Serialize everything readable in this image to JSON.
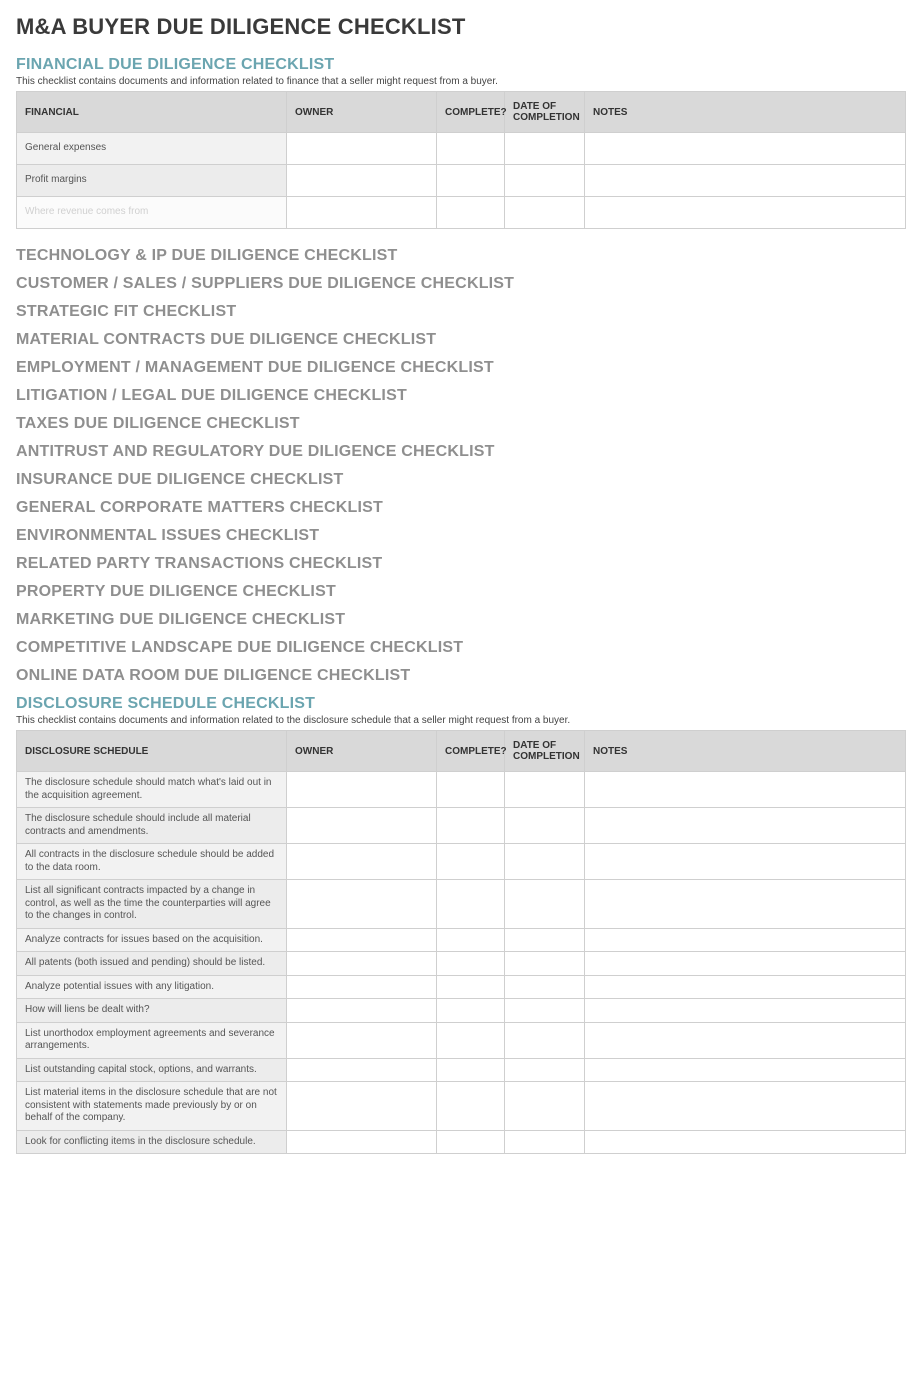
{
  "page_title": "M&A BUYER DUE DILIGENCE CHECKLIST",
  "financial": {
    "title": "FINANCIAL DUE DILIGENCE CHECKLIST",
    "desc": "This checklist contains documents and information related to finance that a seller might request from a buyer.",
    "headers": {
      "first": "FINANCIAL",
      "owner": "OWNER",
      "complete": "COMPLETE?",
      "date": "DATE OF COMPLETION",
      "notes": "NOTES"
    },
    "rows": [
      {
        "item": "General expenses",
        "owner": "",
        "complete": "",
        "date": "",
        "notes": "",
        "fade": false
      },
      {
        "item": "Profit margins",
        "owner": "",
        "complete": "",
        "date": "",
        "notes": "",
        "fade": false
      },
      {
        "item": "Where revenue comes from",
        "owner": "",
        "complete": "",
        "date": "",
        "notes": "",
        "fade": true
      }
    ]
  },
  "middle_sections": [
    "TECHNOLOGY & IP DUE DILIGENCE CHECKLIST",
    "CUSTOMER / SALES / SUPPLIERS DUE DILIGENCE CHECKLIST",
    "STRATEGIC FIT CHECKLIST",
    "MATERIAL CONTRACTS DUE DILIGENCE CHECKLIST",
    "EMPLOYMENT / MANAGEMENT DUE DILIGENCE CHECKLIST",
    "LITIGATION / LEGAL DUE DILIGENCE CHECKLIST",
    "TAXES DUE DILIGENCE CHECKLIST",
    "ANTITRUST AND REGULATORY DUE DILIGENCE CHECKLIST",
    "INSURANCE DUE DILIGENCE CHECKLIST",
    "GENERAL CORPORATE MATTERS CHECKLIST",
    "ENVIRONMENTAL ISSUES CHECKLIST",
    "RELATED PARTY TRANSACTIONS CHECKLIST",
    "PROPERTY DUE DILIGENCE CHECKLIST",
    "MARKETING DUE DILIGENCE CHECKLIST",
    "COMPETITIVE LANDSCAPE DUE DILIGENCE CHECKLIST",
    "ONLINE DATA ROOM DUE DILIGENCE CHECKLIST"
  ],
  "disclosure": {
    "title": "DISCLOSURE SCHEDULE CHECKLIST",
    "desc": "This checklist contains documents and information related to the disclosure schedule that a seller might request from a buyer.",
    "headers": {
      "first": "DISCLOSURE SCHEDULE",
      "owner": "OWNER",
      "complete": "COMPLETE?",
      "date": "DATE OF COMPLETION",
      "notes": "NOTES"
    },
    "rows": [
      {
        "item": "The disclosure schedule should match what's laid out in the acquisition agreement.",
        "owner": "",
        "complete": "",
        "date": "",
        "notes": ""
      },
      {
        "item": "The disclosure schedule should include all material contracts and amendments.",
        "owner": "",
        "complete": "",
        "date": "",
        "notes": ""
      },
      {
        "item": "All contracts in the disclosure schedule should be added to the data room.",
        "owner": "",
        "complete": "",
        "date": "",
        "notes": ""
      },
      {
        "item": "List all significant contracts impacted by a change in control, as well as the time the counterparties will agree to the changes in control.",
        "owner": "",
        "complete": "",
        "date": "",
        "notes": ""
      },
      {
        "item": "Analyze contracts for issues based on the acquisition.",
        "owner": "",
        "complete": "",
        "date": "",
        "notes": ""
      },
      {
        "item": "All patents (both issued and pending) should be listed.",
        "owner": "",
        "complete": "",
        "date": "",
        "notes": ""
      },
      {
        "item": "Analyze potential issues with any litigation.",
        "owner": "",
        "complete": "",
        "date": "",
        "notes": ""
      },
      {
        "item": "How will liens be dealt with?",
        "owner": "",
        "complete": "",
        "date": "",
        "notes": ""
      },
      {
        "item": "List unorthodox employment agreements and severance arrangements.",
        "owner": "",
        "complete": "",
        "date": "",
        "notes": ""
      },
      {
        "item": "List outstanding capital stock, options, and warrants.",
        "owner": "",
        "complete": "",
        "date": "",
        "notes": ""
      },
      {
        "item": "List material items in the disclosure schedule that are not consistent with statements made previously by or on behalf of the company.",
        "owner": "",
        "complete": "",
        "date": "",
        "notes": ""
      },
      {
        "item": "Look for conflicting items in the disclosure schedule.",
        "owner": "",
        "complete": "",
        "date": "",
        "notes": ""
      }
    ]
  }
}
